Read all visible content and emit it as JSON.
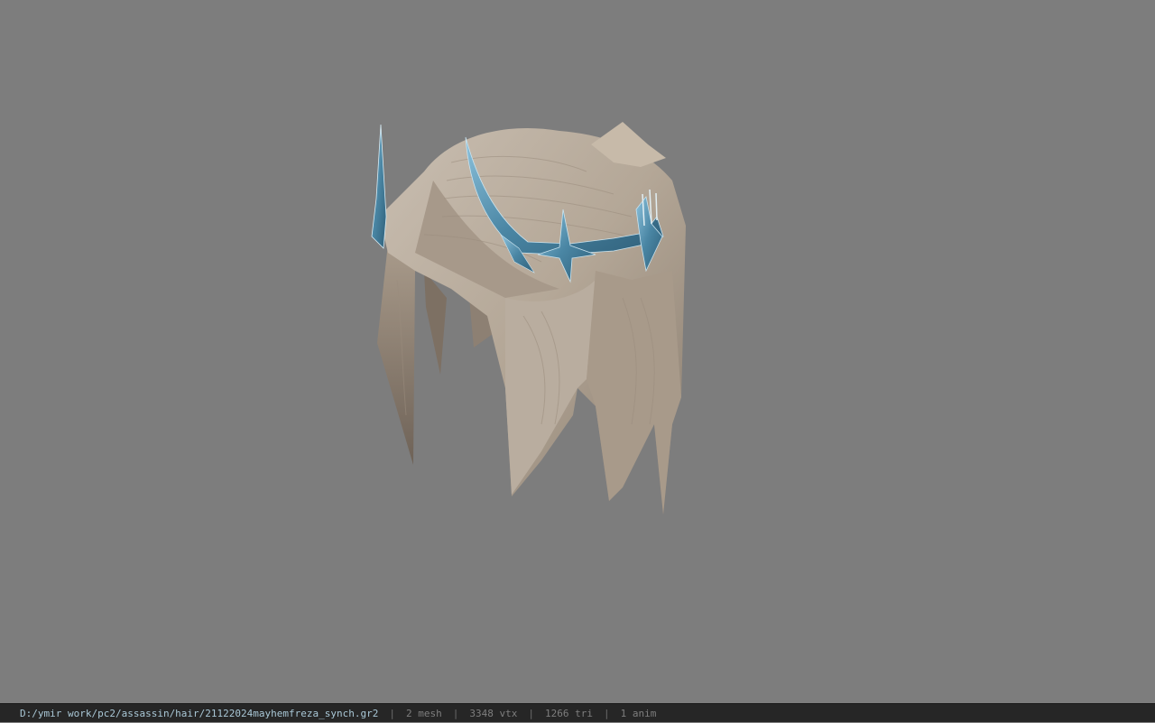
{
  "status_bar": {
    "file_path": "D:/ymir work/pc2/assassin/hair/21122024mayhemfreza_synch.gr2",
    "separator": "|",
    "mesh_count": "2 mesh",
    "vertex_count": "3348 vtx",
    "triangle_count": "1266 tri",
    "anim_count": "1 anim"
  },
  "viewport": {
    "background_color": "#7d7d7d",
    "model_name": "hair-model",
    "hair_color": "#b7aa9b",
    "crown_color": "#4f8aa6"
  }
}
